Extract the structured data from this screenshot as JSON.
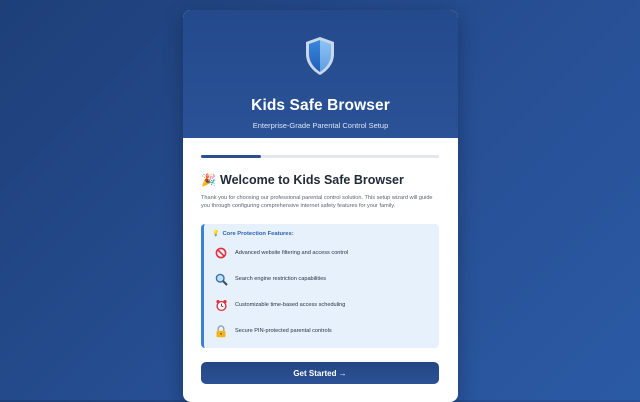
{
  "header": {
    "app_title": "Kids Safe Browser",
    "app_subtitle": "Enterprise-Grade Parental Control Setup",
    "logo_icon": "shield-icon"
  },
  "progress": {
    "fraction": 0.25
  },
  "welcome": {
    "icon": "party-popper-icon",
    "title": "Welcome to Kids Safe Browser",
    "intro": "Thank you for choosing our professional parental control solution. This setup wizard will guide you through configuring comprehensive internet safety features for your family."
  },
  "features": {
    "title_icon": "lightbulb-icon",
    "title": "Core Protection Features:",
    "items": [
      {
        "icon": "prohibited-icon",
        "label": "Advanced website filtering and access control"
      },
      {
        "icon": "magnifier-icon",
        "label": "Search engine restriction capabilities"
      },
      {
        "icon": "alarm-clock-icon",
        "label": "Customizable time-based access scheduling"
      },
      {
        "icon": "lock-icon",
        "label": "Secure PIN-protected parental controls"
      }
    ]
  },
  "cta": {
    "label": "Get Started →"
  },
  "colors": {
    "background": "#274f94",
    "header": "#2a5296",
    "accent": "#3b82d6",
    "features_bg": "#e6f1fb",
    "button": "#2c5296"
  }
}
